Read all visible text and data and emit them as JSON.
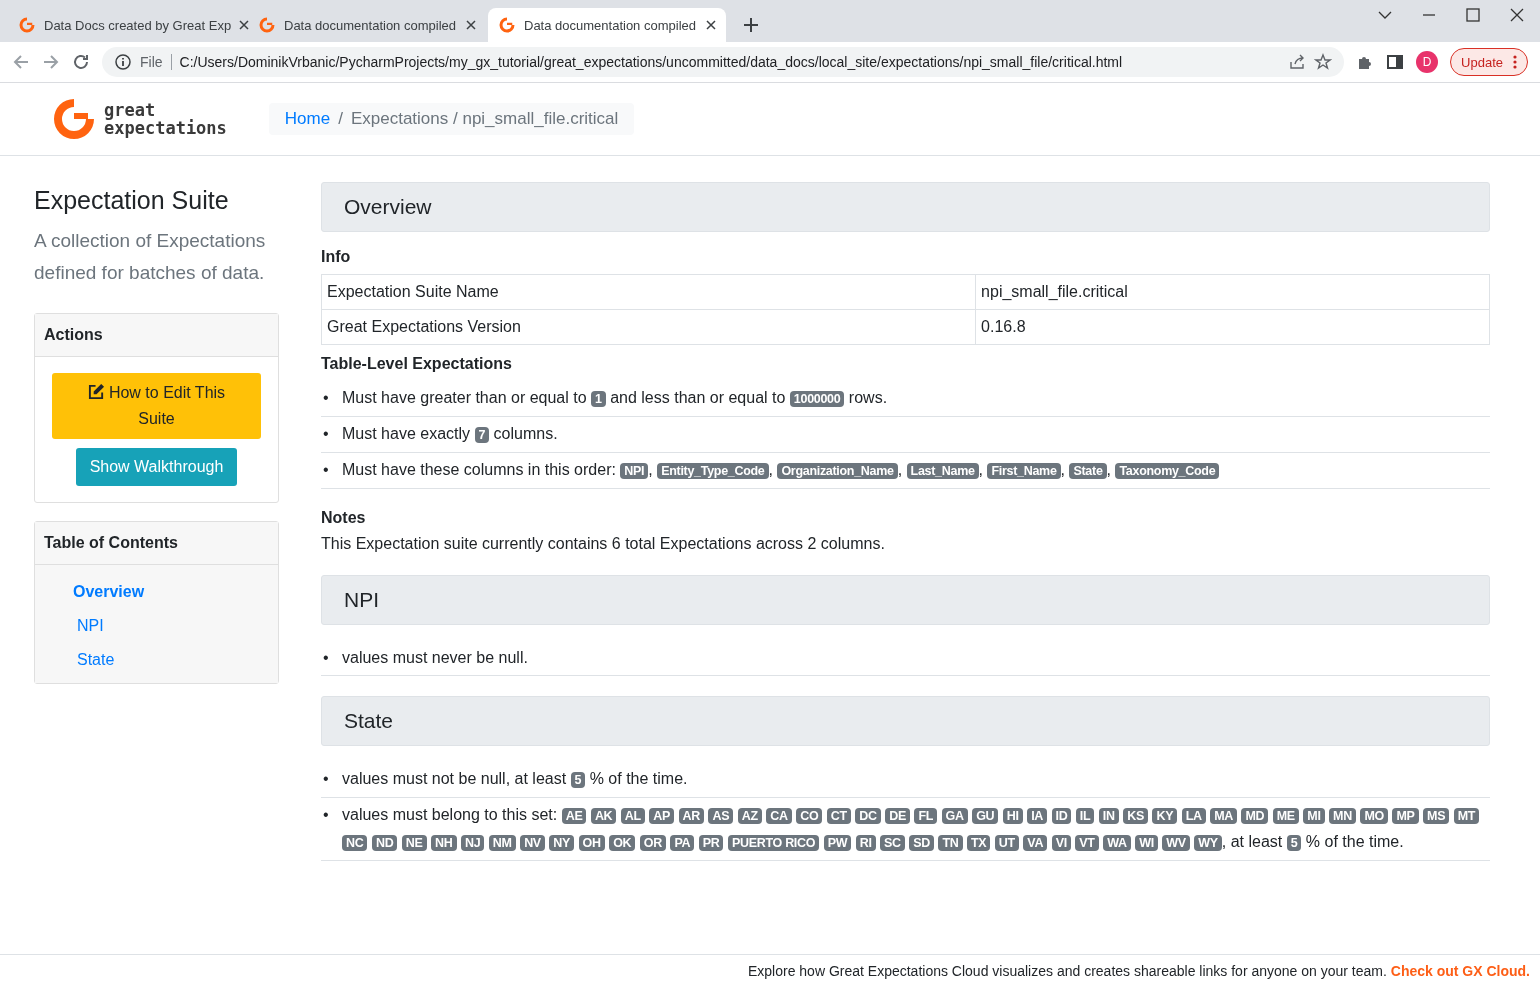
{
  "browser": {
    "tabs": [
      {
        "title": "Data Docs created by Great Exp",
        "selected": false
      },
      {
        "title": "Data documentation compiled",
        "selected": false
      },
      {
        "title": "Data documentation compiled",
        "selected": true
      }
    ],
    "address": {
      "scheme": "File",
      "url": "C:/Users/DominikVrbanic/PycharmProjects/my_gx_tutorial/great_expectations/uncommitted/data_docs/local_site/expectations/npi_small_file/critical.html"
    },
    "profile_initial": "D",
    "update_button": "Update"
  },
  "header": {
    "logo_lines": [
      "great",
      "expectations"
    ],
    "breadcrumb": {
      "home": "Home",
      "separator": "/",
      "current": "Expectations / npi_small_file.critical"
    }
  },
  "sidebar": {
    "title": "Expectation Suite",
    "description": "A collection of Expectations defined for batches of data.",
    "actions": {
      "title": "Actions",
      "buttons": [
        {
          "label": "How to Edit This Suite",
          "kind": "edit"
        },
        {
          "label": "Show Walkthrough",
          "kind": "walkthrough"
        }
      ]
    },
    "toc": {
      "title": "Table of Contents",
      "items": [
        {
          "label": "Overview",
          "selected": true
        },
        {
          "label": "NPI",
          "selected": false
        },
        {
          "label": "State",
          "selected": false
        }
      ]
    }
  },
  "sections": [
    {
      "heading": "Overview",
      "info": {
        "title": "Info",
        "rows": [
          [
            "Expectation Suite Name",
            "npi_small_file.critical"
          ],
          [
            "Great Expectations Version",
            "0.16.8"
          ]
        ]
      },
      "table_level": {
        "title": "Table-Level Expectations",
        "items": [
          [
            {
              "kind": "bullet",
              "text": "•"
            },
            {
              "kind": "text",
              "text": "Must have greater than or equal to "
            },
            {
              "kind": "badge",
              "text": "1"
            },
            {
              "kind": "text",
              "text": " and less than or equal to "
            },
            {
              "kind": "badge",
              "text": "1000000"
            },
            {
              "kind": "text",
              "text": " rows."
            }
          ],
          [
            {
              "kind": "bullet",
              "text": "•"
            },
            {
              "kind": "text",
              "text": "Must have exactly "
            },
            {
              "kind": "badge",
              "text": "7"
            },
            {
              "kind": "text",
              "text": " columns."
            }
          ],
          [
            {
              "kind": "bullet",
              "text": "•"
            },
            {
              "kind": "text",
              "text": "Must have these columns in this order: "
            },
            {
              "kind": "badge",
              "text": "NPI"
            },
            {
              "kind": "text",
              "text": ", "
            },
            {
              "kind": "badge",
              "text": "Entity_Type_Code"
            },
            {
              "kind": "text",
              "text": ", "
            },
            {
              "kind": "badge",
              "text": "Organization_Name"
            },
            {
              "kind": "text",
              "text": ", "
            },
            {
              "kind": "badge",
              "text": "Last_Name"
            },
            {
              "kind": "text",
              "text": ", "
            },
            {
              "kind": "badge",
              "text": "First_Name"
            },
            {
              "kind": "text",
              "text": ", "
            },
            {
              "kind": "badge",
              "text": "State"
            },
            {
              "kind": "text",
              "text": ", "
            },
            {
              "kind": "badge",
              "text": "Taxonomy_Code"
            }
          ]
        ]
      },
      "notes": {
        "title": "Notes",
        "text": "This Expectation suite currently contains 6 total Expectations across 2 columns."
      }
    },
    {
      "heading": "NPI",
      "items": [
        [
          {
            "kind": "bullet",
            "text": "•"
          },
          {
            "kind": "text",
            "text": "values must never be null."
          }
        ]
      ]
    },
    {
      "heading": "State",
      "items": [
        [
          {
            "kind": "bullet",
            "text": "•"
          },
          {
            "kind": "text",
            "text": "values must not be null, at least "
          },
          {
            "kind": "badge",
            "text": "5"
          },
          {
            "kind": "text",
            "text": " % of the time."
          }
        ],
        [
          {
            "kind": "bullet",
            "text": "•"
          },
          {
            "kind": "text",
            "text": "values must belong to this set: "
          },
          {
            "kind": "badge_set",
            "items": [
              "AE",
              "AK",
              "AL",
              "AP",
              "AR",
              "AS",
              "AZ",
              "CA",
              "CO",
              "CT",
              "DC",
              "DE",
              "FL",
              "GA",
              "GU",
              "HI",
              "IA",
              "ID",
              "IL",
              "IN",
              "KS",
              "KY",
              "LA",
              "MA",
              "MD",
              "ME",
              "MI",
              "MN",
              "MO",
              "MP",
              "MS",
              "MT",
              "NC",
              "ND",
              "NE",
              "NH",
              "NJ",
              "NM",
              "NV",
              "NY",
              "OH",
              "OK",
              "OR",
              "PA",
              "PR",
              "PUERTO RICO",
              "PW",
              "RI",
              "SC",
              "SD",
              "TN",
              "TX",
              "UT",
              "VA",
              "VI",
              "VT",
              "WA",
              "WI",
              "WV",
              "WY"
            ]
          },
          {
            "kind": "text",
            "text": ", at least "
          },
          {
            "kind": "badge",
            "text": "5"
          },
          {
            "kind": "text",
            "text": " % of the time."
          }
        ]
      ]
    }
  ],
  "footer": {
    "text": "Explore how Great Expectations Cloud visualizes and creates shareable links for anyone on your team.",
    "link": "Check out GX Cloud."
  }
}
